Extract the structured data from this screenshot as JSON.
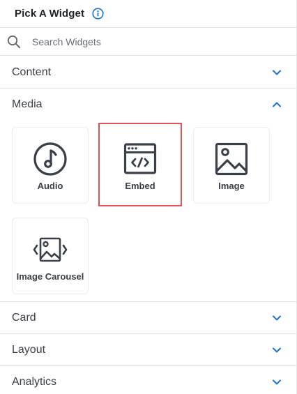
{
  "header": {
    "title": "Pick A Widget",
    "info_icon": "info-icon"
  },
  "search": {
    "placeholder": "Search Widgets",
    "value": "",
    "icon": "search-icon"
  },
  "sections": [
    {
      "label": "Content",
      "expanded": false
    },
    {
      "label": "Media",
      "expanded": true
    },
    {
      "label": "Card",
      "expanded": false
    },
    {
      "label": "Layout",
      "expanded": false
    },
    {
      "label": "Analytics",
      "expanded": false
    }
  ],
  "media": {
    "widgets": [
      {
        "label": "Audio",
        "icon": "music-note-icon",
        "selected": false
      },
      {
        "label": "Embed",
        "icon": "code-window-icon",
        "selected": true
      },
      {
        "label": "Image",
        "icon": "image-icon",
        "selected": false
      },
      {
        "label": "Image Carousel",
        "icon": "image-carousel-icon",
        "selected": false
      }
    ]
  },
  "colors": {
    "accent": "#1a73c8",
    "selected_border": "#e05255",
    "divider": "#e3e3e3",
    "icon": "#3b3f46"
  }
}
